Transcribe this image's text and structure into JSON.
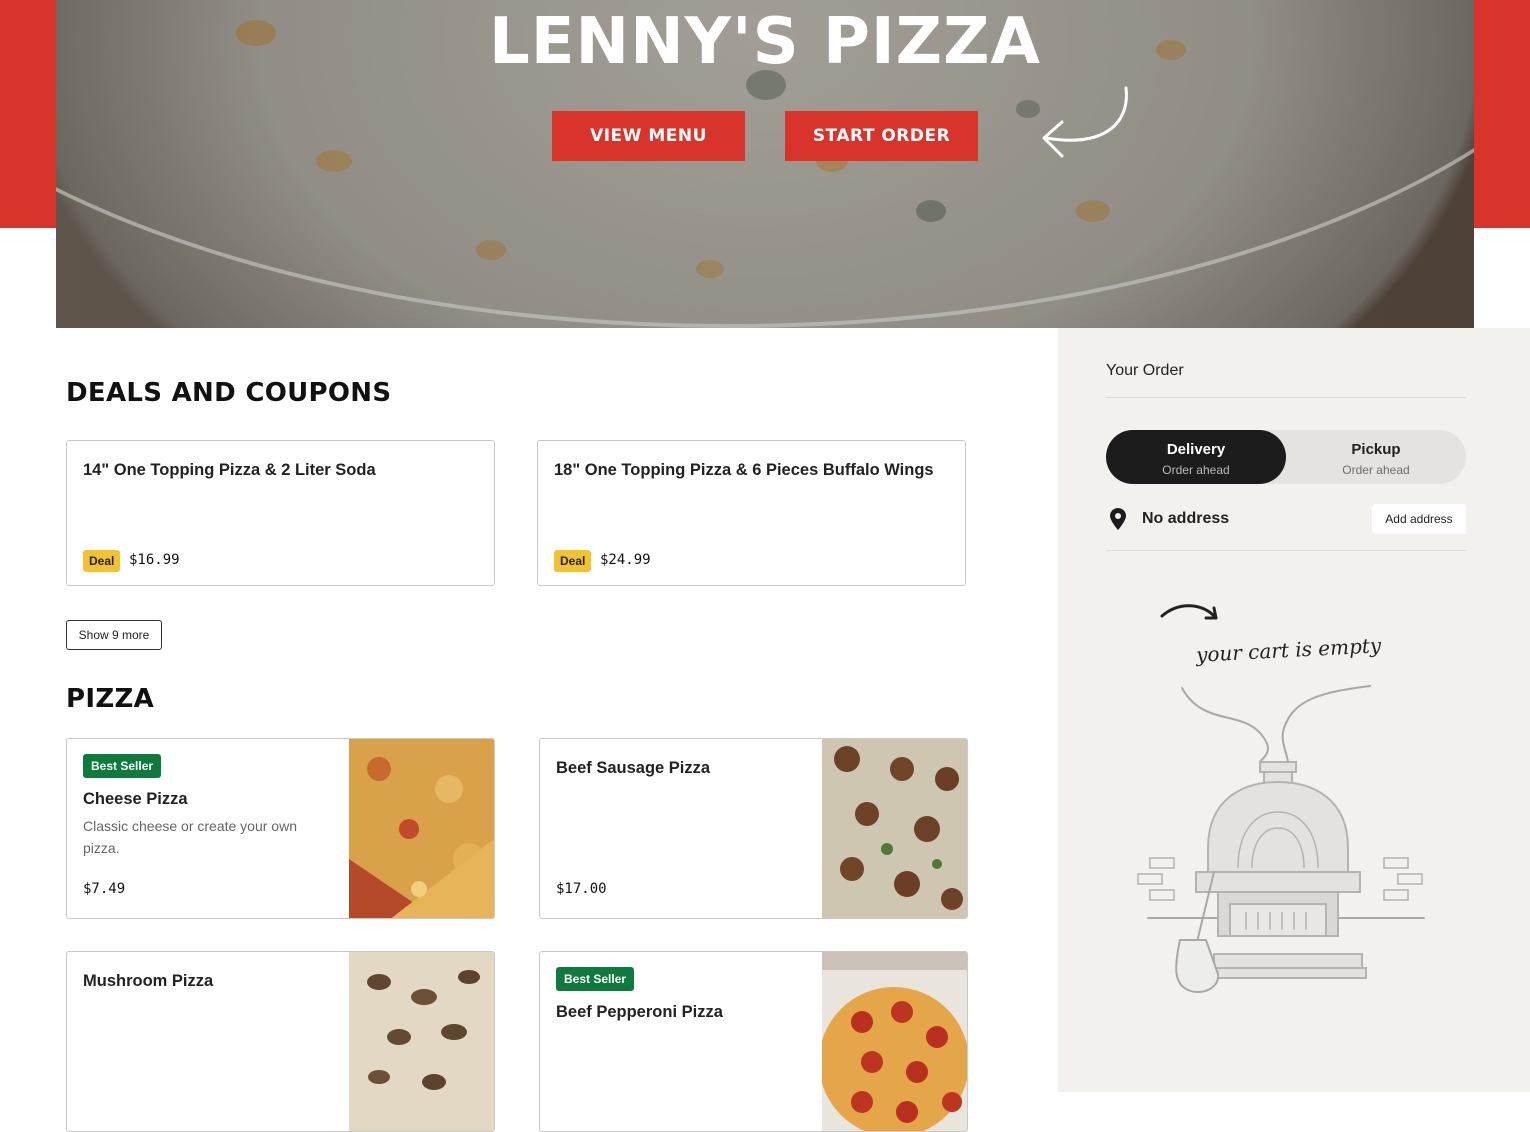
{
  "hero": {
    "title": "LENNY'S PIZZA",
    "view_menu_label": "VIEW MENU",
    "start_order_label": "START ORDER"
  },
  "deals": {
    "heading": "DEALS AND COUPONS",
    "items": [
      {
        "name": "14\" One Topping Pizza & 2 Liter Soda",
        "badge": "Deal",
        "price": "$16.99"
      },
      {
        "name": "18\" One Topping Pizza & 6 Pieces Buffalo Wings",
        "badge": "Deal",
        "price": "$24.99"
      }
    ],
    "show_more_label": "Show 9 more"
  },
  "pizza": {
    "heading": "PIZZA",
    "items": [
      {
        "badge": "Best Seller",
        "name": "Cheese Pizza",
        "description": "Classic cheese or create your own pizza.",
        "price": "$7.49"
      },
      {
        "name": "Beef Sausage Pizza",
        "price": "$17.00"
      },
      {
        "name": "Mushroom Pizza"
      },
      {
        "badge": "Best Seller",
        "name": "Beef Pepperoni Pizza"
      }
    ]
  },
  "order": {
    "title": "Your Order",
    "delivery": {
      "label": "Delivery",
      "sub": "Order ahead"
    },
    "pickup": {
      "label": "Pickup",
      "sub": "Order ahead"
    },
    "no_address": "No address",
    "add_address_label": "Add address",
    "empty_text": "your cart is empty"
  },
  "colors": {
    "brand_red": "#d9342b",
    "deal_badge": "#f2c230",
    "best_seller_badge": "#0f7a3e",
    "sidebar_bg": "#f2f1ee",
    "toggle_active": "#1d1c1c"
  },
  "icons": [
    "curved-arrow-icon",
    "location-pin-icon",
    "hand-drawn-arrow-icon",
    "pizza-oven-illustration"
  ]
}
